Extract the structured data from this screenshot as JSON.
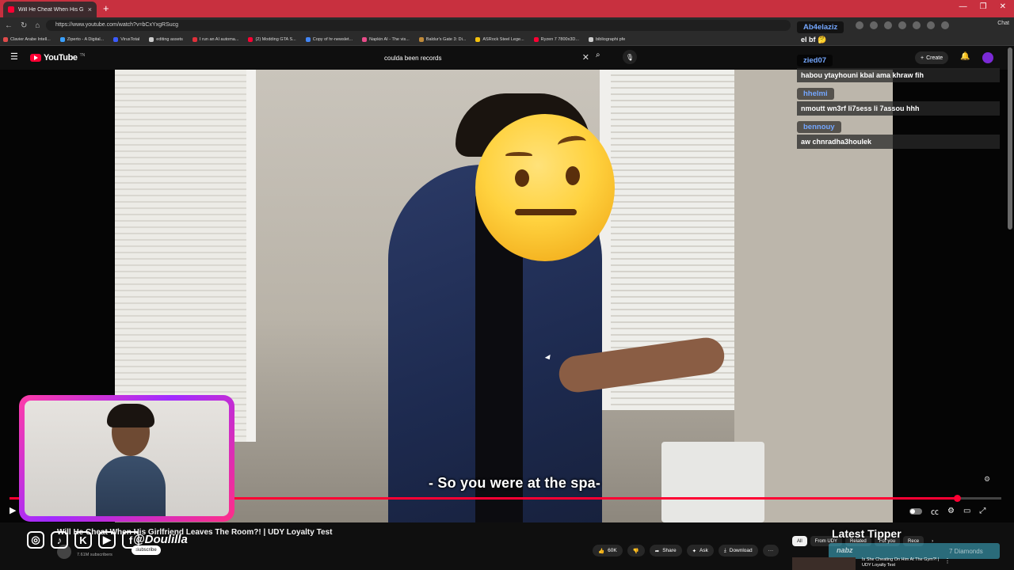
{
  "browser": {
    "tab_title": "Will He Cheat When His Girlfri",
    "tab_close": "×",
    "new_tab": "+",
    "url": "https://www.youtube.com/watch?v=bCxYxgRSucg",
    "chat_button": "Chat",
    "window_controls": [
      "—",
      "❐",
      "✕"
    ],
    "bookmarks": [
      {
        "label": "Clavier Arabe Intell...",
        "color": "#e04b4b"
      },
      {
        "label": "Ziperto - A Digital...",
        "color": "#3aa0ff"
      },
      {
        "label": "VirusTotal",
        "color": "#3b5bff"
      },
      {
        "label": "editing assets",
        "color": "#cccccc"
      },
      {
        "label": "I run an AI automa...",
        "color": "#e0303a"
      },
      {
        "label": "(2) Modding GTA S...",
        "color": "#ff0033"
      },
      {
        "label": "Copy of hr-newslet...",
        "color": "#4285f4"
      },
      {
        "label": "Napkin AI - The vis...",
        "color": "#e94c89"
      },
      {
        "label": "Baldur's Gate 3: Di...",
        "color": "#c08a3a"
      },
      {
        "label": "ASRock Steel Lege...",
        "color": "#f4c20d"
      },
      {
        "label": "Ryzen 7 7800x3D...",
        "color": "#ff0033"
      },
      {
        "label": "bibliographi pfe",
        "color": "#cccccc"
      }
    ]
  },
  "youtube": {
    "logo": "YouTube",
    "logo_tm": "TN",
    "search_value": "coulda been records",
    "clear_icon": "✕",
    "search_icon": "⌕",
    "mic_icon": "🎙",
    "create_label": "Create",
    "bell_icon": "🔔"
  },
  "video": {
    "caption": "- So you were at the spa-",
    "progress": 0.955,
    "title": "Will He Cheat When His Girlfriend Leaves The Room?! | UDY Loyalty Test",
    "subscribers": "7.61M subscribers",
    "subscribe_label": "Subscribe",
    "likes": "60K",
    "share_label": "Share",
    "ask_label": "Ask",
    "download_label": "Download",
    "more_label": "···",
    "play_icon": "▶"
  },
  "streamer": {
    "handle": "@Doulilla",
    "socials": [
      "◎",
      "♪",
      "K",
      "▶",
      "f"
    ]
  },
  "chat": {
    "messages": [
      {
        "user": "Ab4elaziz",
        "text": "el bf 🤔"
      },
      {
        "user": "zied07",
        "text": "habou ytayhouni kbal ama khraw fih"
      },
      {
        "user": "hhelmi",
        "text": "nmoutt wn3rf li7sess li 7assou hhh"
      },
      {
        "user": "bennouy",
        "text": "aw chnradha3houlek"
      }
    ]
  },
  "sidebar": {
    "chips": [
      "All",
      "From UDY",
      "Related",
      "For you",
      "Rece"
    ],
    "chip_next": "›",
    "latest_tipper_label": "Latest Tipper",
    "tipper_name": "nabz",
    "tipper_amount": "7 Diamonds",
    "rec_title": "Is She Cheating On Him At The Gym?! | UDY Loyalty Test",
    "rec_menu": "⋮"
  }
}
